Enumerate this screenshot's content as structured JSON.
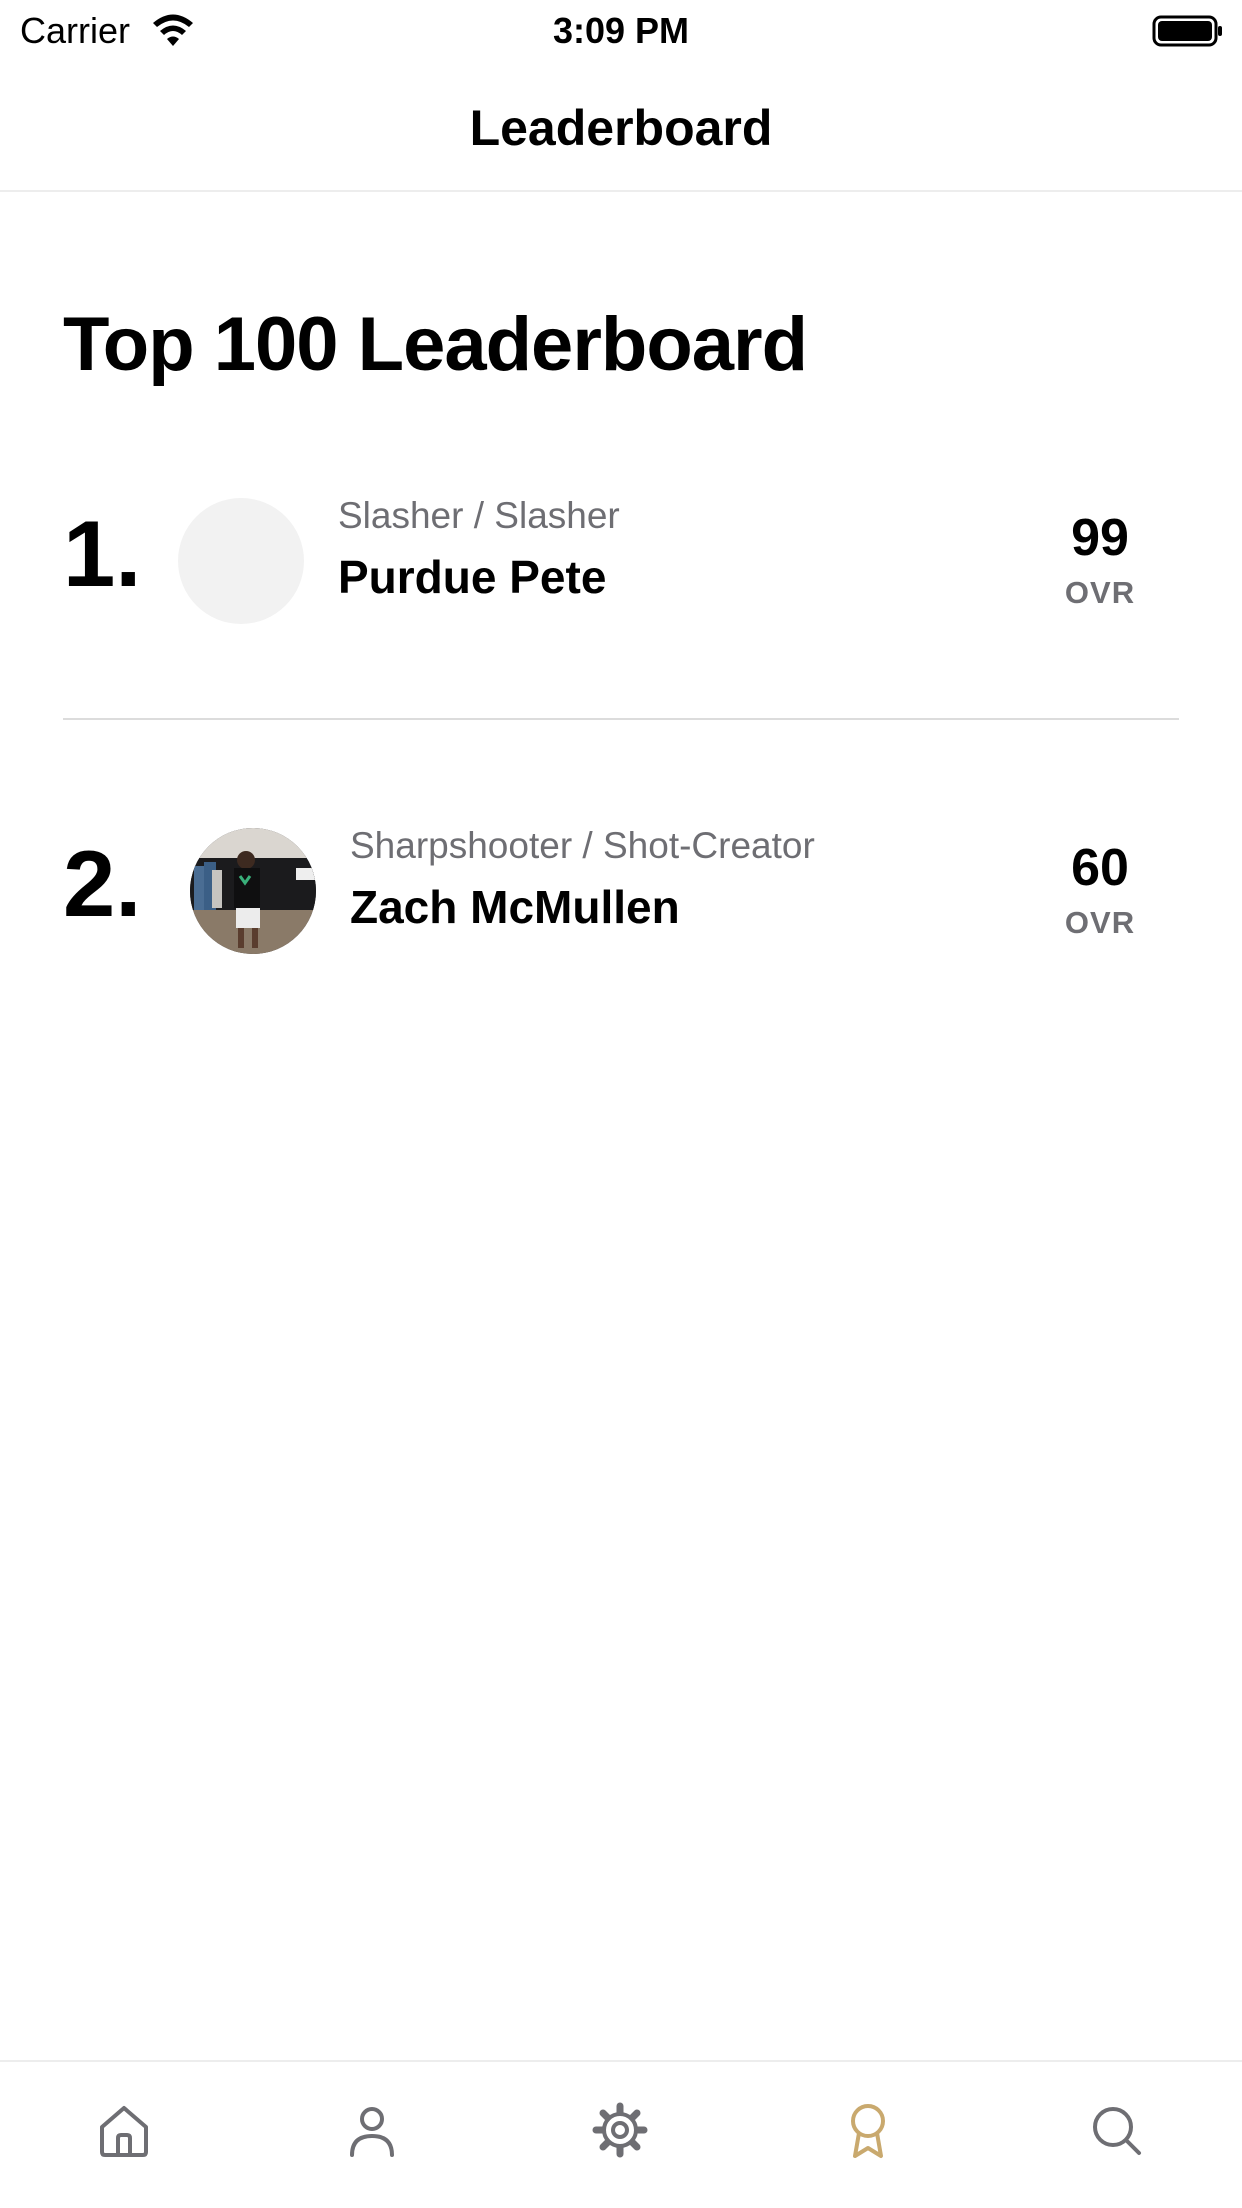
{
  "status_bar": {
    "carrier": "Carrier",
    "time": "3:09 PM",
    "wifi_icon": "wifi-icon",
    "battery_icon": "battery-icon"
  },
  "nav": {
    "title": "Leaderboard"
  },
  "page": {
    "heading": "Top 100 Leaderboard"
  },
  "leaderboard": [
    {
      "rank": "1.",
      "archetype": "Slasher / Slasher",
      "name": "Purdue Pete",
      "ovr": "99",
      "ovr_label": "OVR",
      "avatar": "empty"
    },
    {
      "rank": "2.",
      "archetype": "Sharpshooter / Shot-Creator",
      "name": "Zach McMullen",
      "ovr": "60",
      "ovr_label": "OVR",
      "avatar": "photo"
    }
  ],
  "tab_bar": {
    "tabs": [
      {
        "icon": "home-icon",
        "active": false
      },
      {
        "icon": "person-icon",
        "active": false
      },
      {
        "icon": "gear-icon",
        "active": false
      },
      {
        "icon": "award-icon",
        "active": true
      },
      {
        "icon": "search-icon",
        "active": false
      }
    ],
    "active_color": "#c9a96e",
    "inactive_color": "#6e6e73"
  }
}
